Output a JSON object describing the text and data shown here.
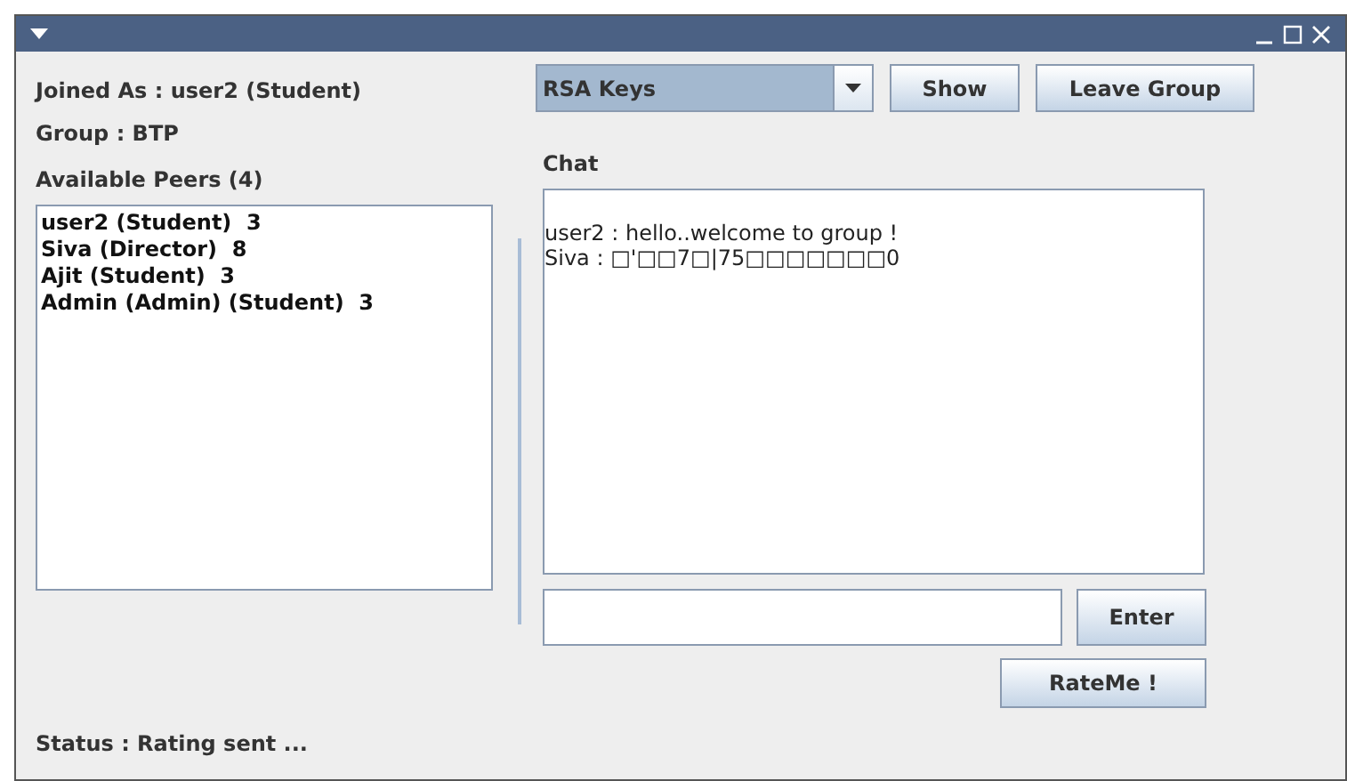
{
  "joined_as": "Joined As : user2 (Student)",
  "group": "Group : BTP",
  "peers": {
    "label": "Available Peers (4)",
    "items": [
      "user2 (Student)  3",
      "Siva (Director)  8",
      "Ajit (Student)  3",
      "Admin (Admin) (Student)  3"
    ]
  },
  "key_select": {
    "value": "RSA Keys"
  },
  "buttons": {
    "show": "Show",
    "leave": "Leave Group",
    "enter": "Enter",
    "rate": "RateMe !"
  },
  "chat": {
    "label": "Chat",
    "messages": [
      "user2 : hello..welcome to group !",
      "Siva : □'□□7□|75□□□□□□□0"
    ]
  },
  "status": "Status : Rating sent ..."
}
